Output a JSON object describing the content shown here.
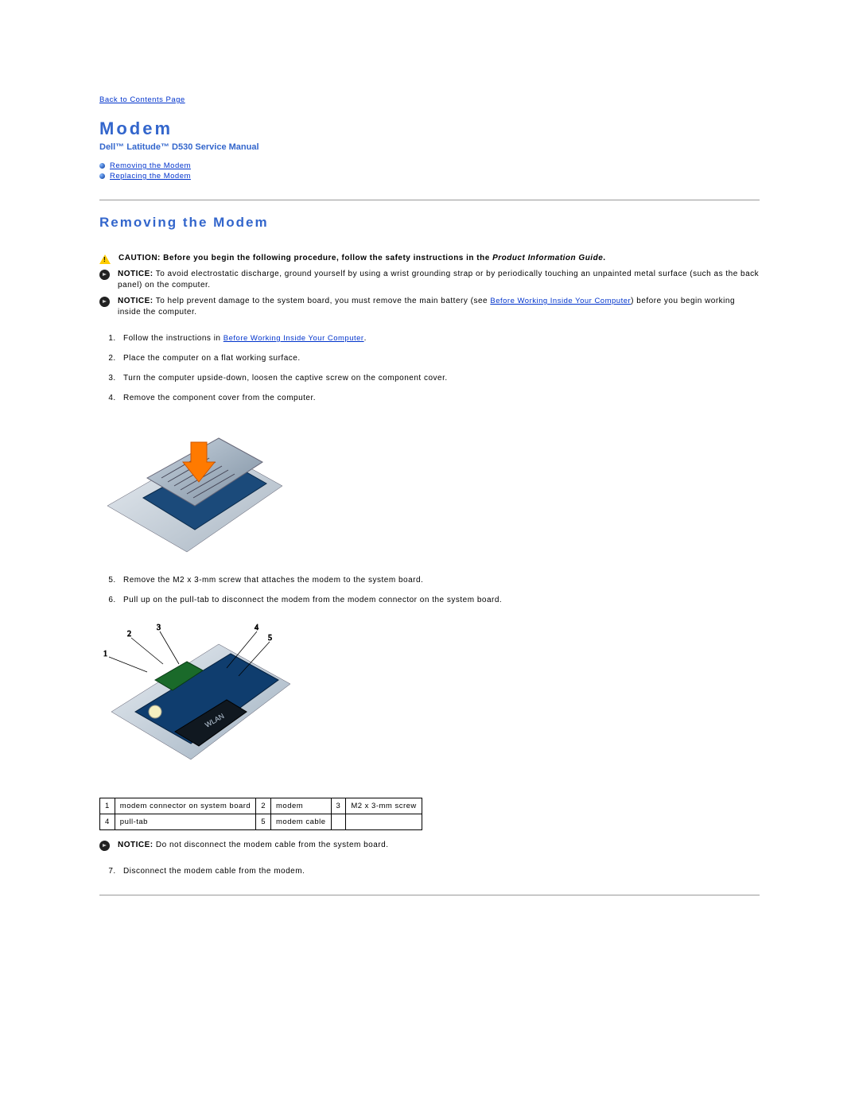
{
  "nav": {
    "back_to_contents": "Back to Contents Page"
  },
  "header": {
    "title": "Modem",
    "subtitle": "Dell™ Latitude™ D530 Service Manual"
  },
  "toc": {
    "items": [
      {
        "label": "Removing the Modem"
      },
      {
        "label": "Replacing the Modem"
      }
    ]
  },
  "section": {
    "heading": "Removing the Modem"
  },
  "admonitions": {
    "caution_label": "CAUTION:",
    "caution_text_a": "Before you begin the following procedure, follow the safety instructions in the ",
    "caution_text_b": "Product Information Guide",
    "caution_text_c": ".",
    "notice1_label": "NOTICE:",
    "notice1_text": "To avoid electrostatic discharge, ground yourself by using a wrist grounding strap or by periodically touching an unpainted metal surface (such as the back panel) on the computer.",
    "notice2_label": "NOTICE:",
    "notice2_text_a": "To help prevent damage to the system board, you must remove the main battery (see ",
    "notice2_link": "Before Working Inside Your Computer",
    "notice2_text_b": ") before you begin working inside the computer.",
    "notice3_label": "NOTICE:",
    "notice3_text": "Do not disconnect the modem cable from the system board."
  },
  "steps": {
    "s1a": "Follow the instructions in ",
    "s1link": "Before Working Inside Your Computer",
    "s1b": ".",
    "s2": "Place the computer on a flat working surface.",
    "s3": "Turn the computer upside-down, loosen the captive screw on the component cover.",
    "s4": "Remove the component cover from the computer.",
    "s5": "Remove the M2 x 3-mm screw that attaches the modem to the system board.",
    "s6": "Pull up on the pull-tab to disconnect the modem from the modem connector on the system board.",
    "s7": "Disconnect the modem cable from the modem."
  },
  "callouts": {
    "n1": "1",
    "l1": "modem connector on system board",
    "n2": "2",
    "l2": "modem",
    "n3": "3",
    "l3": "M2 x 3-mm screw",
    "n4": "4",
    "l4": "pull-tab",
    "n5": "5",
    "l5": "modem cable",
    "n6": "",
    "l6": ""
  }
}
